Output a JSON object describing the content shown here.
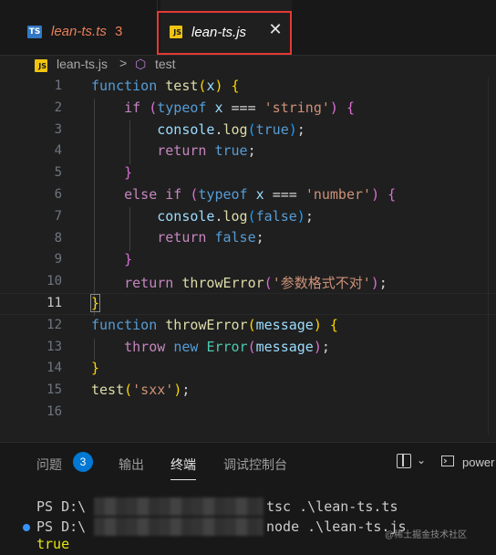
{
  "tabs": [
    {
      "badge": "TS",
      "label": "lean-ts.ts",
      "problems": "3"
    },
    {
      "badge": "JS",
      "label": "lean-ts.js",
      "close": "✕"
    }
  ],
  "breadcrumb": {
    "file_badge": "JS",
    "file": "lean-ts.js",
    "separator": ">",
    "symbol_icon": "⬡",
    "symbol": "test"
  },
  "editor": {
    "line_numbers": [
      "1",
      "2",
      "3",
      "4",
      "5",
      "6",
      "7",
      "8",
      "9",
      "10",
      "11",
      "12",
      "13",
      "14",
      "15",
      "16"
    ],
    "active_line": "11",
    "code": {
      "l1": {
        "kw": "function",
        "fn": "test",
        "p1": "(",
        "arg": "x",
        "p2": ")",
        "brace": "{"
      },
      "l2": {
        "kw": "if",
        "p1": "(",
        "typeof": "typeof",
        "x": "x",
        "op": "===",
        "str": "'string'",
        "p2": ")",
        "brace": "{"
      },
      "l3": {
        "obj": "console",
        "dot": ".",
        "m": "log",
        "p1": "(",
        "val": "true",
        "p2": ")",
        "semi": ";"
      },
      "l4": {
        "kw": "return",
        "val": "true",
        "semi": ";"
      },
      "l5": {
        "brace": "}"
      },
      "l6": {
        "kw1": "else",
        "kw2": "if",
        "p1": "(",
        "typeof": "typeof",
        "x": "x",
        "op": "===",
        "str": "'number'",
        "p2": ")",
        "brace": "{"
      },
      "l7": {
        "obj": "console",
        "dot": ".",
        "m": "log",
        "p1": "(",
        "val": "false",
        "p2": ")",
        "semi": ";"
      },
      "l8": {
        "kw": "return",
        "val": "false",
        "semi": ";"
      },
      "l9": {
        "brace": "}"
      },
      "l10": {
        "kw": "return",
        "fn": "throwError",
        "p1": "(",
        "str": "'参数格式不对'",
        "p2": ")",
        "semi": ";"
      },
      "l11": {
        "brace": "}"
      },
      "l12": {
        "kw": "function",
        "fn": "throwError",
        "p1": "(",
        "arg": "message",
        "p2": ")",
        "brace": "{"
      },
      "l13": {
        "kw": "throw",
        "kw2": "new",
        "cls": "Error",
        "p1": "(",
        "arg": "message",
        "p2": ")",
        "semi": ";"
      },
      "l14": {
        "brace": "}"
      },
      "l15": {
        "fn": "test",
        "p1": "(",
        "str": "'sxx'",
        "p2": ")",
        "semi": ";"
      }
    }
  },
  "panel": {
    "tabs": [
      "问题",
      "输出",
      "终端",
      "调试控制台"
    ],
    "problems_count": "3",
    "active_tab": "终端",
    "terminal_name": "power"
  },
  "terminal": {
    "line1": {
      "prompt": "PS D:\\",
      "cmd": "tsc .\\lean-ts.ts"
    },
    "line2": {
      "prompt": "PS D:\\",
      "cmd": "node .\\lean-ts.js"
    },
    "line3": "true"
  },
  "watermark": "@稀土掘金技术社区",
  "colors": {
    "ts": "#3178c6",
    "js": "#f1c40f",
    "highlight": "#e53935",
    "badge": "#0078d4"
  }
}
